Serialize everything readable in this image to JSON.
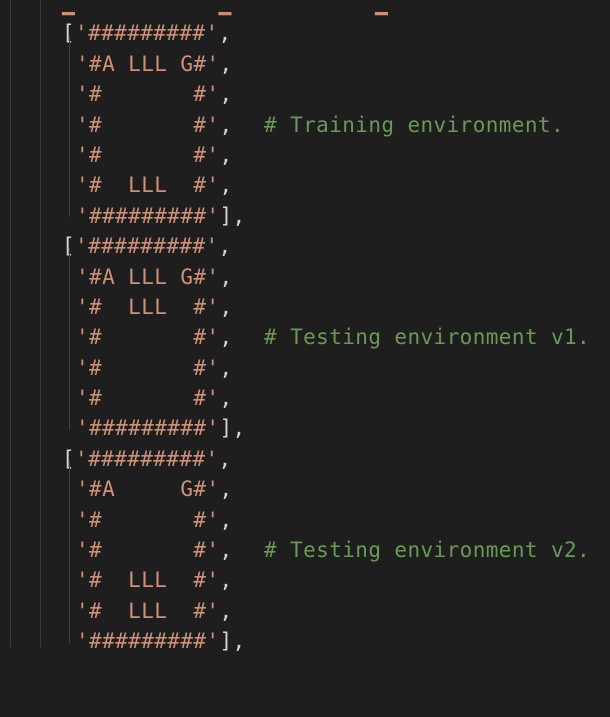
{
  "blocks": [
    {
      "open": "'#########'",
      "rows": [
        "'#A LLL G#'",
        "'#       #'",
        "'#       #'",
        "'#       #'",
        "'#  LLL  #'"
      ],
      "close": "'#########'",
      "comment": "# Training environment."
    },
    {
      "open": "'#########'",
      "rows": [
        "'#A LLL G#'",
        "'#  LLL  #'",
        "'#       #'",
        "'#       #'",
        "'#       #'"
      ],
      "close": "'#########'",
      "comment": "# Testing environment v1."
    },
    {
      "open": "'#########'",
      "rows": [
        "'#A     G#'",
        "'#       #'",
        "'#       #'",
        "'#  LLL  #'",
        "'#  LLL  #'"
      ],
      "close": "'#########'",
      "comment": "# Testing environment v2."
    }
  ],
  "punctuation": {
    "open_bracket": "[",
    "comma": ",",
    "close": "],"
  },
  "colors": {
    "background": "#1e1e1e",
    "string": "#ce9178",
    "comment": "#6a9955",
    "punctuation": "#d4d4d4"
  }
}
